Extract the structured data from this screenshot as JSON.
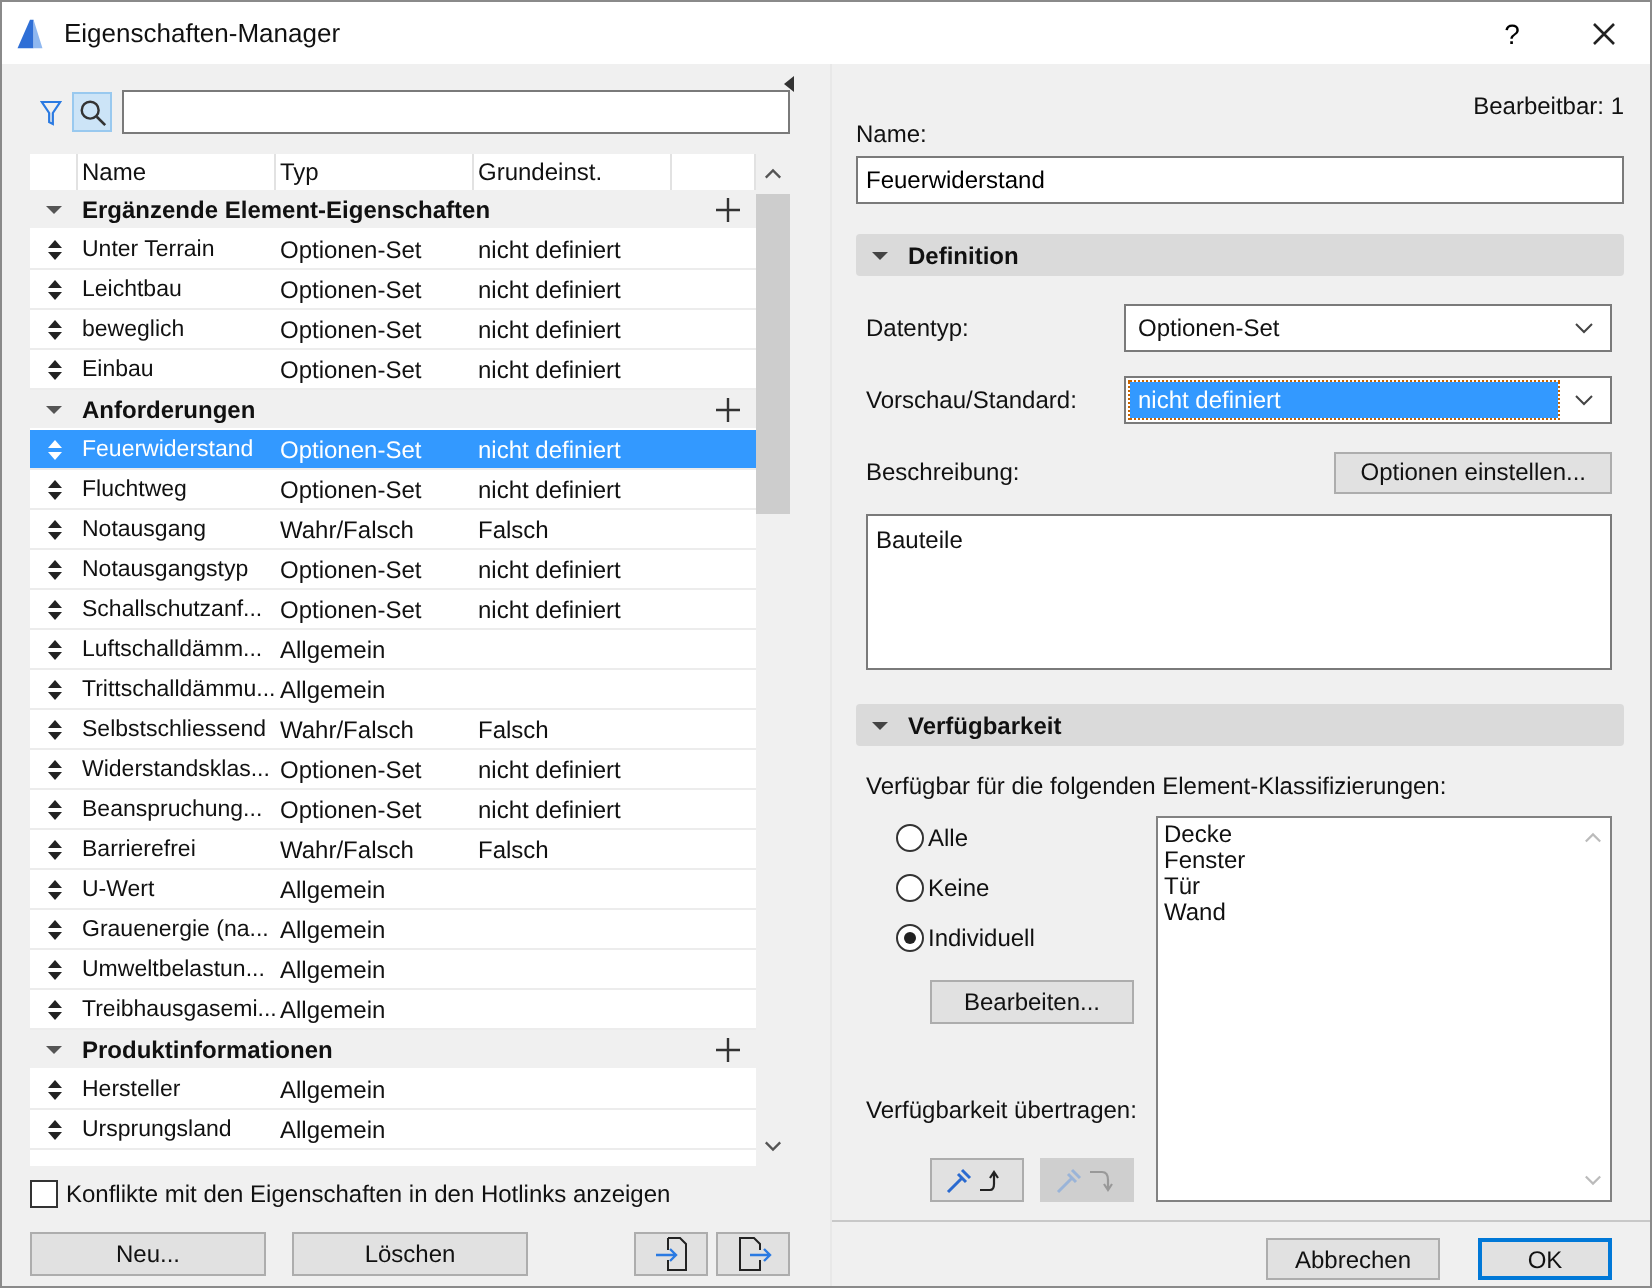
{
  "window": {
    "title": "Eigenschaften-Manager",
    "help": "?"
  },
  "left": {
    "search": {
      "search_on": true
    },
    "columns": [
      "Name",
      "Typ",
      "Grundeinst."
    ],
    "groups": [
      {
        "name": "Ergänzende Element-Eigenschaften",
        "expanded": true,
        "rows": [
          {
            "name": "Unter Terrain",
            "type": "Optionen-Set",
            "default": "nicht definiert",
            "selected": false
          },
          {
            "name": "Leichtbau",
            "type": "Optionen-Set",
            "default": "nicht definiert",
            "selected": false
          },
          {
            "name": "beweglich",
            "type": "Optionen-Set",
            "default": "nicht definiert",
            "selected": false
          },
          {
            "name": "Einbau",
            "type": "Optionen-Set",
            "default": "nicht definiert",
            "selected": false
          }
        ]
      },
      {
        "name": "Anforderungen",
        "expanded": true,
        "rows": [
          {
            "name": "Feuerwiderstand",
            "type": "Optionen-Set",
            "default": "nicht definiert",
            "selected": true
          },
          {
            "name": "Fluchtweg",
            "type": "Optionen-Set",
            "default": "nicht definiert",
            "selected": false
          },
          {
            "name": "Notausgang",
            "type": "Wahr/Falsch",
            "default": "Falsch",
            "selected": false
          },
          {
            "name": "Notausgangstyp",
            "type": "Optionen-Set",
            "default": "nicht definiert",
            "selected": false
          },
          {
            "name": "Schallschutzanf...",
            "type": "Optionen-Set",
            "default": "nicht definiert",
            "selected": false
          },
          {
            "name": "Luftschalldämm...",
            "type": "Allgemein",
            "selected": false
          },
          {
            "name": "Trittschalldämmu...",
            "type": "Allgemein",
            "selected": false
          },
          {
            "name": "Selbstschliessend",
            "type": "Wahr/Falsch",
            "default": "Falsch",
            "selected": false
          },
          {
            "name": "Widerstandsklas...",
            "type": "Optionen-Set",
            "default": "nicht definiert",
            "selected": false
          },
          {
            "name": "Beanspruchung...",
            "type": "Optionen-Set",
            "default": "nicht definiert",
            "selected": false
          },
          {
            "name": "Barrierefrei",
            "type": "Wahr/Falsch",
            "default": "Falsch",
            "selected": false
          },
          {
            "name": "U-Wert",
            "type": "Allgemein",
            "selected": false
          },
          {
            "name": "Grauenergie (na...",
            "type": "Allgemein",
            "selected": false
          },
          {
            "name": "Umweltbelastun...",
            "type": "Allgemein",
            "selected": false
          },
          {
            "name": "Treibhausgasemi...",
            "type": "Allgemein",
            "selected": false
          }
        ]
      },
      {
        "name": "Produktinformationen",
        "expanded": true,
        "rows": [
          {
            "name": "Hersteller",
            "type": "Allgemein",
            "selected": false
          },
          {
            "name": "Ursprungsland",
            "type": "Allgemein",
            "selected": false
          }
        ]
      }
    ],
    "conflicts": {
      "label": "Konflikte mit den Eigenschaften in den Hotlinks anzeigen",
      "checked": false
    },
    "buttons": [
      "Neu...",
      "Löschen"
    ]
  },
  "right": {
    "editable": "Bearbeitbar: 1",
    "name_label": "Name:",
    "name_value": "Feuerwiderstand",
    "definition": {
      "title": "Definition",
      "expanded": true,
      "datatype_label": "Datentyp:",
      "datatype": "Optionen-Set",
      "preview_label": "Vorschau/Standard:",
      "preview": "nicht definiert",
      "description_label": "Beschreibung:",
      "options_button": "Optionen einstellen...",
      "description": "Bauteile"
    },
    "availability": {
      "title": "Verfügbarkeit",
      "expanded": true,
      "intro": "Verfügbar für die folgenden Element-Klassifizierungen:",
      "radios": [
        {
          "label": "Alle",
          "selected": false
        },
        {
          "label": "Keine",
          "selected": false
        },
        {
          "label": "Individuell",
          "selected": true
        }
      ],
      "edit_button": "Bearbeiten...",
      "transfer_label": "Verfügbarkeit übertragen:",
      "transfer_buttons": [
        {
          "kind": "pick",
          "disabled": false
        },
        {
          "kind": "apply",
          "disabled": true
        }
      ],
      "classifications": [
        "Decke",
        "Fenster",
        "Tür",
        "Wand"
      ]
    },
    "buttons": [
      {
        "label": "Abbrechen",
        "default": false
      },
      {
        "label": "OK",
        "default": true
      }
    ]
  }
}
